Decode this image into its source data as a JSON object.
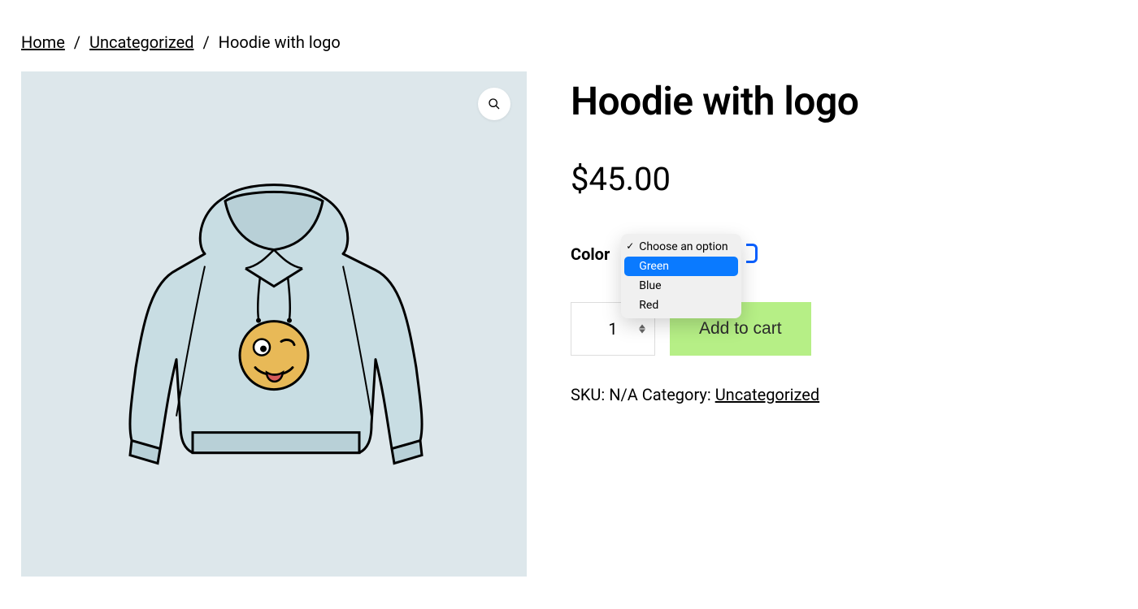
{
  "breadcrumb": {
    "home": "Home",
    "category": "Uncategorized",
    "current": "Hoodie with logo"
  },
  "product": {
    "title": "Hoodie with logo",
    "price": "$45.00",
    "variation_label": "Color",
    "dropdown": {
      "placeholder": "Choose an option",
      "options": [
        "Green",
        "Blue",
        "Red"
      ],
      "highlighted": "Green"
    },
    "quantity": "1",
    "add_to_cart": "Add to cart",
    "meta": {
      "sku_label": "SKU:",
      "sku_value": "N/A",
      "category_label": "Category:",
      "category_value": "Uncategorized"
    }
  }
}
